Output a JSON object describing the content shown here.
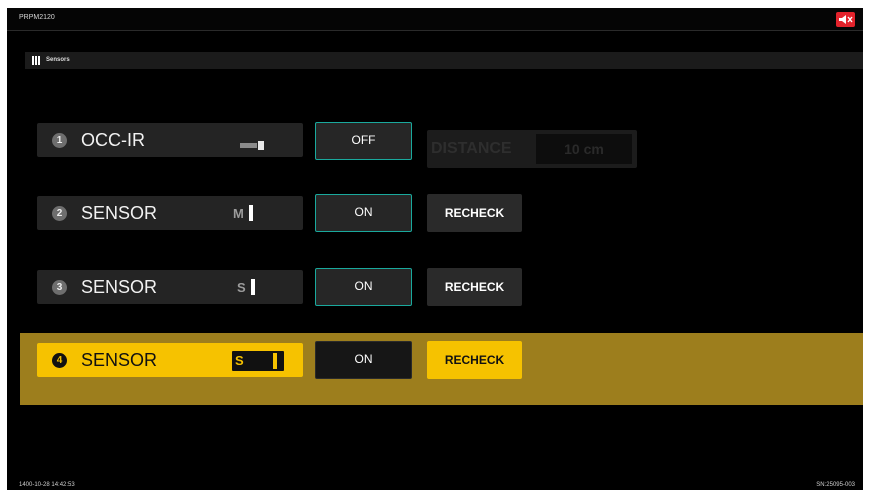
{
  "header": {
    "device_name": "PRPM2120"
  },
  "section": {
    "title": "Sensors"
  },
  "rows": [
    {
      "num": "1",
      "name": "OCC-IR",
      "indicator": "",
      "toggle": "OFF",
      "distance_label": "DISTANCE",
      "distance_value": "10 cm"
    },
    {
      "num": "2",
      "name": "SENSOR",
      "indicator": "M",
      "indicator_small": "",
      "toggle": "ON",
      "action": "RECHECK"
    },
    {
      "num": "3",
      "name": "SENSOR",
      "indicator": "S",
      "indicator_small": "",
      "toggle": "ON",
      "action": "RECHECK"
    },
    {
      "num": "4",
      "name": "SENSOR",
      "indicator": "S",
      "indicator_small": "",
      "toggle": "ON",
      "action": "RECHECK",
      "active": true
    }
  ],
  "footer": {
    "datetime": "1400-10-28 14:42:53",
    "serial": "SN:25095-003"
  },
  "colors": {
    "accent": "#f6c200",
    "active_row_bg": "#9d7e1d",
    "toggle_border": "#1aa99d",
    "mute": "#e3232c"
  },
  "icons": {
    "mute": "speaker-mute-icon",
    "section": "grid-icon",
    "occ": "ir-beam-icon"
  }
}
